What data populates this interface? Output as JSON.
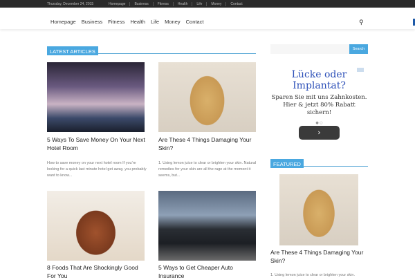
{
  "topbar": {
    "date": "Thursday, December 24, 2015",
    "links": [
      "Homepage",
      "Business",
      "Fitness",
      "Health",
      "Life",
      "Money",
      "Contact"
    ]
  },
  "nav": {
    "items": [
      "Homepage",
      "Business",
      "Fitness",
      "Health",
      "Life",
      "Money",
      "Contact"
    ]
  },
  "latest": {
    "heading": "LATEST ARTICLES",
    "articles": [
      {
        "title": "5 Ways To Save Money On Your Next Hotel Room",
        "excerpt": "How to save money on your next hotel room If you're looking for a quick last minute hotel get away, you probably want to know..."
      },
      {
        "title": "Are These 4 Things Damaging Your Skin?",
        "excerpt": "1. Using lemon juice to clear or brighten your skin. Natural remedies for your skin are all the rage at the moment it seems, but..."
      },
      {
        "title": "8 Foods That Are Shockingly Good For You",
        "excerpt": ""
      },
      {
        "title": "5 Ways to Get Cheaper Auto Insurance",
        "excerpt": ""
      }
    ]
  },
  "sidebar": {
    "search_button": "Search",
    "search_placeholder": "",
    "ad": {
      "headline": "Lücke oder Implantat?",
      "body": "Sparen Sie mit uns Zahnkosten. Hier & jetzt 80% Rabatt sichern!",
      "arrow": "›"
    },
    "featured": {
      "heading": "FEATURED",
      "title": "Are These 4 Things Damaging Your Skin?",
      "excerpt": "1. Using lemon juice to clear or brighten your skin."
    }
  }
}
